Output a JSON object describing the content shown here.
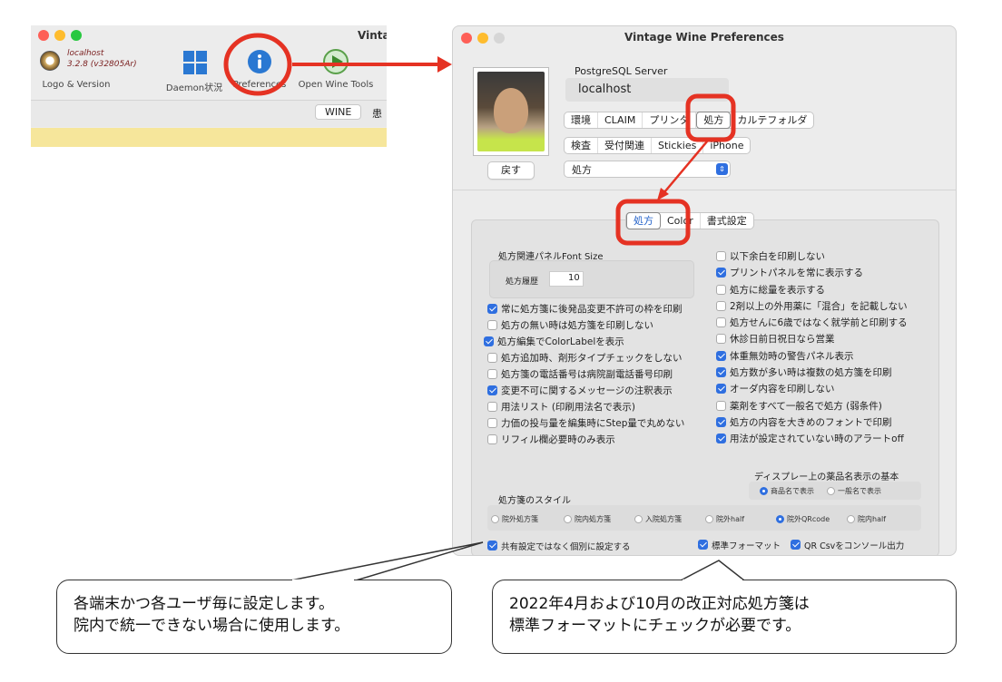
{
  "mini_window": {
    "title": "Vinta",
    "logo": {
      "line1": "localhost",
      "line2": "3.2.8 (v32805Ar)",
      "label": "Logo & Version"
    },
    "toolbar": [
      {
        "label": "Daemon状況",
        "icon": "grid-icon"
      },
      {
        "label": "Preferences",
        "icon": "info-icon"
      },
      {
        "label": "Open Wine Tools",
        "icon": "play-icon"
      }
    ],
    "tab": "WINE",
    "tab_next": "患"
  },
  "pref_window": {
    "title": "Vintage Wine Preferences",
    "back_button": "戻す",
    "server_label": "PostgreSQL Server",
    "server_value": "localhost",
    "seg_row1": [
      "環境",
      "CLAIM",
      "プリンタ",
      "処方",
      "カルテフォルダ"
    ],
    "seg_row2": [
      "検査",
      "受付関連",
      "Stickies",
      "iPhone"
    ],
    "category_select": "処方",
    "tabs": [
      "処方",
      "Color",
      "書式設定"
    ],
    "font_size_label": "処方関連パネルFont Size",
    "history_label": "処方履歴",
    "history_value": "10",
    "left_checks": [
      {
        "label": "常に処方箋に後発品変更不許可の枠を印刷",
        "checked": true
      },
      {
        "label": "処方の無い時は処方箋を印刷しない",
        "checked": false
      },
      {
        "label": "処方編集でColorLabelを表示",
        "checked": true
      },
      {
        "label": "処方追加時、剤形タイプチェックをしない",
        "checked": false
      },
      {
        "label": "処方箋の電話番号は病院副電話番号印刷",
        "checked": false
      },
      {
        "label": "変更不可に関するメッセージの注釈表示",
        "checked": true
      },
      {
        "label": "用法リスト (印刷用法名で表示)",
        "checked": false
      },
      {
        "label": "力価の投与量を編集時にStep量で丸めない",
        "checked": false
      },
      {
        "label": "リフィル欄必要時のみ表示",
        "checked": false
      }
    ],
    "right_checks": [
      {
        "label": "以下余白を印刷しない",
        "checked": false
      },
      {
        "label": "プリントパネルを常に表示する",
        "checked": true
      },
      {
        "label": "処方に総量を表示する",
        "checked": false
      },
      {
        "label": "2剤以上の外用薬に「混合」を記載しない",
        "checked": false
      },
      {
        "label": "処方せんに6歳ではなく就学前と印刷する",
        "checked": false
      },
      {
        "label": "休診日前日祝日なら営業",
        "checked": false
      },
      {
        "label": "体重無効時の警告パネル表示",
        "checked": true
      },
      {
        "label": "処方数が多い時は複数の処方箋を印刷",
        "checked": true
      },
      {
        "label": "オーダ内容を印刷しない",
        "checked": true
      },
      {
        "label": "薬剤をすべて一般名で処方 (弱条件)",
        "checked": false
      },
      {
        "label": "処方の内容を大きめのフォントで印刷",
        "checked": true
      },
      {
        "label": "用法が設定されていない時のアラートoff",
        "checked": true
      }
    ],
    "drug_display": {
      "label": "ディスプレー上の薬品名表示の基本",
      "options": [
        {
          "label": "商品名で表示",
          "selected": true
        },
        {
          "label": "一般名で表示",
          "selected": false
        }
      ]
    },
    "style": {
      "label": "処方箋のスタイル",
      "options": [
        {
          "label": "院外処方箋",
          "selected": false
        },
        {
          "label": "院内処方箋",
          "selected": false
        },
        {
          "label": "入院処方箋",
          "selected": false
        },
        {
          "label": "院外half",
          "selected": false
        },
        {
          "label": "院外QRcode",
          "selected": true
        },
        {
          "label": "院内half",
          "selected": false
        }
      ]
    },
    "bottom_checks": [
      {
        "label": "共有設定ではなく個別に設定する",
        "checked": true
      },
      {
        "label": "標準フォーマット",
        "checked": true
      },
      {
        "label": "QR Csvをコンソール出力",
        "checked": true
      }
    ]
  },
  "callouts": {
    "left": [
      "各端末かつ各ユーザ毎に設定します。",
      "院内で統一できない場合に使用します。"
    ],
    "right": [
      "2022年4月および10月の改正対応処方箋は",
      "標準フォーマットにチェックが必要です。"
    ]
  },
  "colors": {
    "annotation_red": "#e53223",
    "accent_blue": "#2f6fe0",
    "warning_yellow": "#f6e69b"
  }
}
